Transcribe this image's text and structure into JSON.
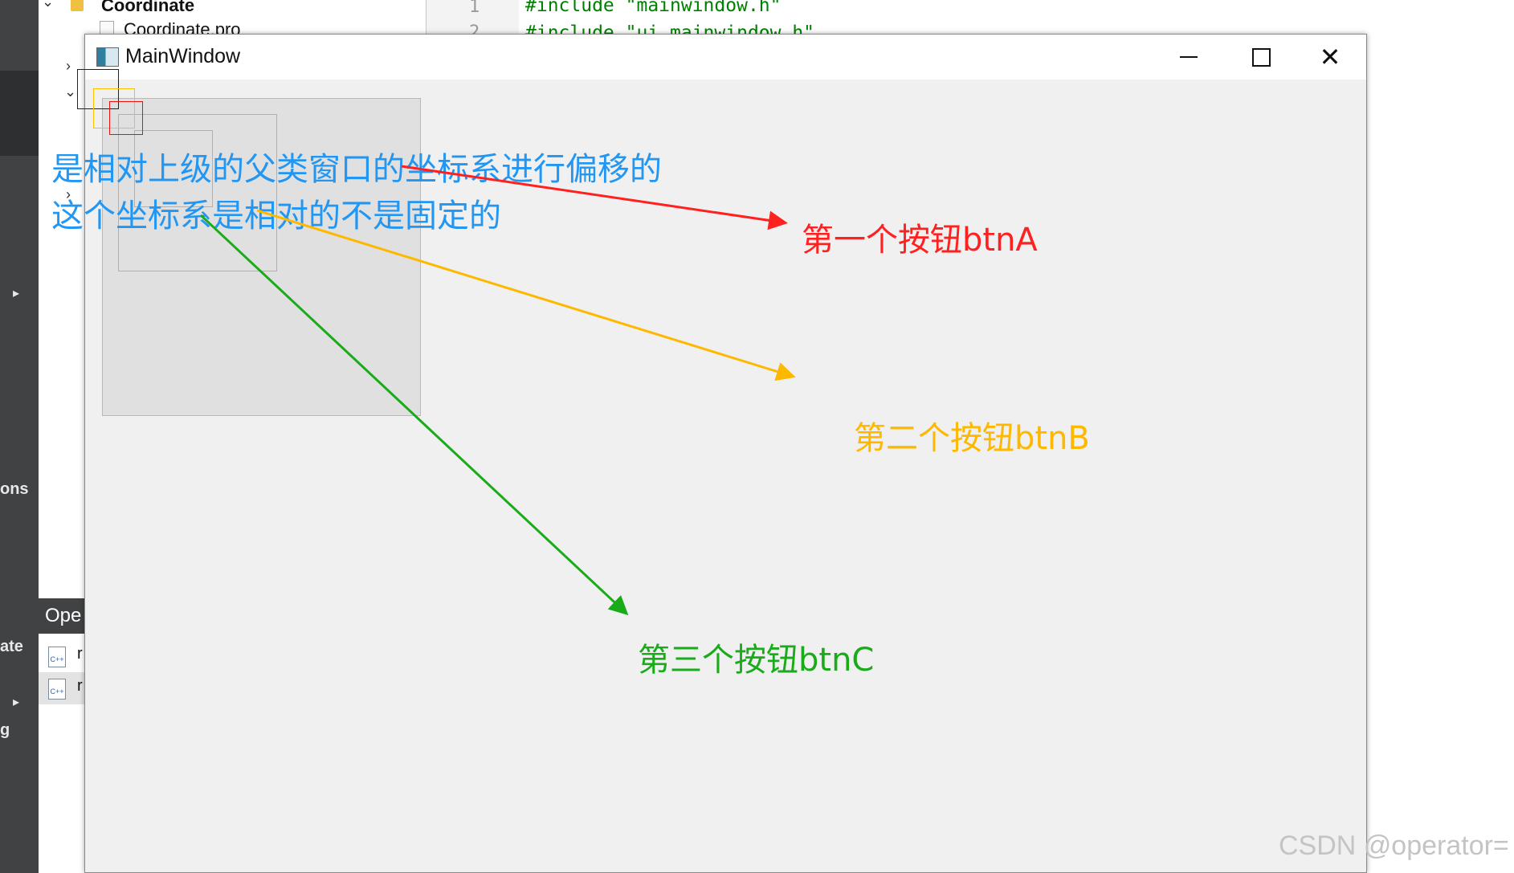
{
  "ide": {
    "left_labels": [
      "ons",
      "ate",
      "g"
    ],
    "project_name": "Coordinate",
    "project_file": "Coordinate.pro",
    "open_documents_header": "Ope",
    "open_doc_rows": [
      "r",
      "r"
    ],
    "line_numbers": [
      "1",
      "2"
    ],
    "code_lines": [
      "#include \"mainwindow.h\"",
      "#include \"ui_mainwindow.h\""
    ]
  },
  "window": {
    "title": "MainWindow",
    "icons": {
      "app": "app-window-icon",
      "minimize": "minimize-icon",
      "maximize": "maximize-icon",
      "close": "close-icon"
    }
  },
  "annotation": {
    "line1": "是相对上级的父类窗口的坐标系进行偏移的",
    "line2": "这个坐标系是相对的不是固定的"
  },
  "labels": {
    "btnA": "第一个按钮btnA",
    "btnB": "第二个按钮btnB",
    "btnC": "第三个按钮btnC"
  },
  "colors": {
    "annotation": "#2196f3",
    "btnA": "#ff2020",
    "btnB": "#ffb800",
    "btnC": "#1aab1a"
  },
  "watermark": "CSDN @operator="
}
